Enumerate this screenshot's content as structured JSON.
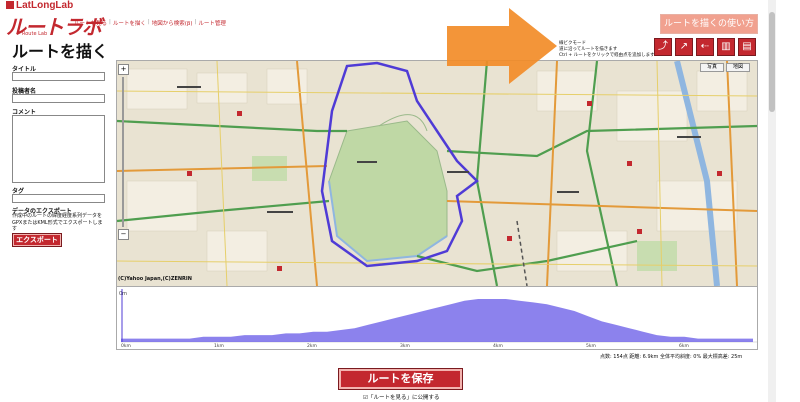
{
  "brand": {
    "name": "LatLongLab",
    "logo": "ルートラボ",
    "tagline": "Route Lab"
  },
  "nav": [
    "ルートを見る",
    "ルートを描く",
    "地図から検索(β)",
    "ルート管理"
  ],
  "page_title": "ルートを描く",
  "form": {
    "title_label": "タイトル",
    "author_label": "投稿者名",
    "comment_label": "コメント",
    "tag_label": "タグ",
    "export_heading": "データのエクスポート",
    "export_desc": "作成中のルートの緯度経度系列データをGPXまたはKML形式でエクスポートします",
    "export_button": "エクスポート"
  },
  "map": {
    "copyright": "(C)Yahoo Japan,(C)ZENRIN",
    "zoom_in": "+",
    "zoom_out": "−",
    "controls": [
      "写真",
      "地図"
    ]
  },
  "mode": {
    "title": "線ビクモード",
    "line1": "道に沿ってルートを描きます",
    "line2": "Ctrl + ルートをクリックで経由点を追加します"
  },
  "top_button": "ルートを描くの使い方",
  "tool_icons": [
    "road-follow-icon",
    "straight-line-icon",
    "undo-icon",
    "trash-icon",
    "document-icon"
  ],
  "elevation": {
    "y_label": "0m",
    "x_ticks": [
      "0km",
      "1km",
      "2km",
      "3km",
      "4km",
      "5km",
      "6km"
    ],
    "profile": [
      2,
      2,
      2,
      2,
      2,
      2,
      3,
      3,
      3,
      4,
      4,
      4,
      5,
      5,
      6,
      6,
      7,
      8,
      10,
      12,
      14,
      16,
      18,
      20,
      22,
      24,
      25,
      25,
      25,
      24,
      23,
      22,
      20,
      18,
      15,
      12,
      10,
      8,
      6,
      4,
      3,
      3,
      2,
      2,
      2,
      2,
      2
    ],
    "max": 25
  },
  "stats": "点数: 154点  距離: 6.9km  全体平均斜度: 0%  最大標高差: 25m",
  "save_button": "ルートを保存",
  "publish_text": "「ルートを見る」に公開する",
  "colors": {
    "accent": "#c3282f",
    "route": "#4f3bd6",
    "arrow": "#f28c28"
  }
}
